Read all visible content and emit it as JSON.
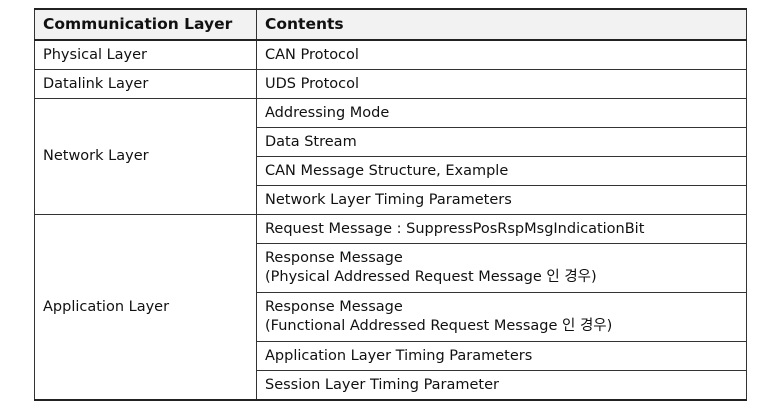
{
  "table": {
    "headers": [
      "Communication Layer",
      "Contents"
    ],
    "groups": [
      {
        "layer": "Physical Layer",
        "contents": [
          [
            "CAN Protocol"
          ]
        ]
      },
      {
        "layer": "Datalink Layer",
        "contents": [
          [
            "UDS Protocol"
          ]
        ]
      },
      {
        "layer": "Network Layer",
        "contents": [
          [
            "Addressing Mode"
          ],
          [
            "Data Stream"
          ],
          [
            "CAN Message Structure, Example"
          ],
          [
            "Network Layer Timing Parameters"
          ]
        ]
      },
      {
        "layer": "Application Layer",
        "contents": [
          [
            "Request Message : SuppressPosRspMsgIndicationBit"
          ],
          [
            "Response Message",
            "(Physical Addressed Request Message 인 경우)"
          ],
          [
            "Response Message",
            "(Functional Addressed Request Message 인 경우)"
          ],
          [
            "Application Layer Timing Parameters"
          ],
          [
            "Session Layer Timing Parameter"
          ]
        ]
      }
    ]
  }
}
